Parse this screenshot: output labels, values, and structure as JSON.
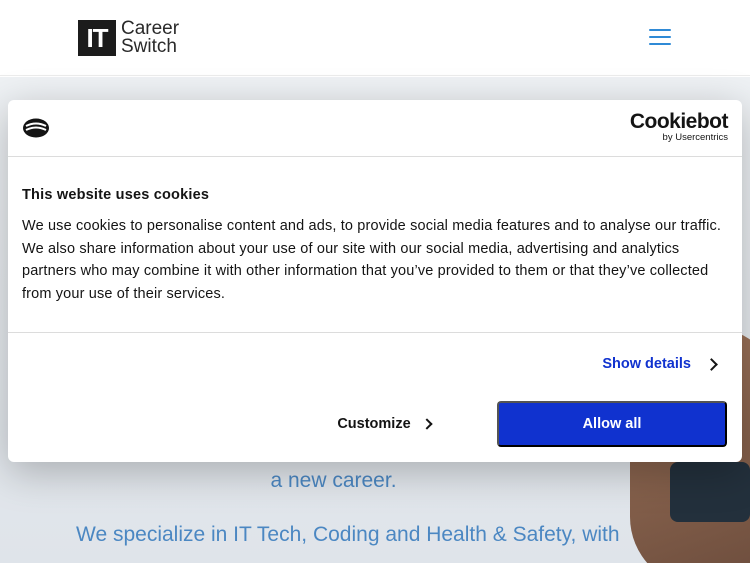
{
  "header": {
    "logo_mark": "IT",
    "logo_line1": "Career",
    "logo_line2": "Switch"
  },
  "hero": {
    "line1": "a new career.",
    "line2": "We specialize in IT Tech, Coding and Health & Safety, with"
  },
  "cookie_dialog": {
    "brand_name": "Cookiebot",
    "brand_sub": "by Usercentrics",
    "title": "This website uses cookies",
    "body": "We use cookies to personalise content and ads, to provide social media features and to analyse our traffic. We also share information about your use of our site with our social media, advertising and analytics partners who may combine it with other information that you’ve provided to them or that they’ve collected from your use of their services.",
    "show_details_label": "Show details",
    "customize_label": "Customize",
    "allow_all_label": "Allow all"
  },
  "colors": {
    "accent_blue": "#1032cf",
    "hero_text": "#4b87c2",
    "menu_icon": "#2f8ad6"
  }
}
